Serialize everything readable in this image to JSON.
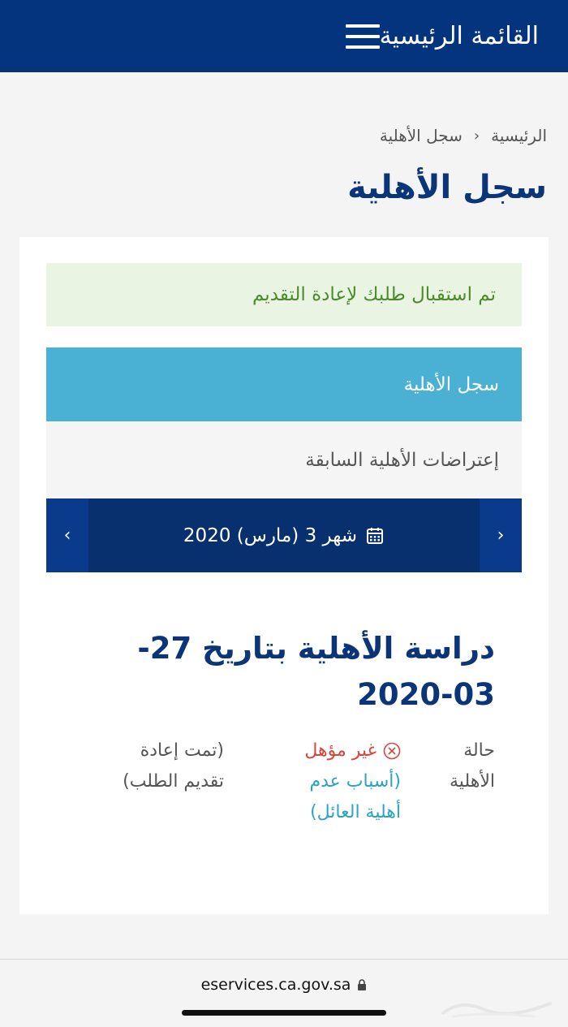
{
  "header": {
    "title": "القائمة الرئيسية",
    "menu_icon": "hamburger-menu-icon"
  },
  "breadcrumb": {
    "home": "الرئيسية",
    "current": "سجل الأهلية"
  },
  "page_title": "سجل الأهلية",
  "alert": {
    "message": "تم استقبال طلبك لإعادة التقديم",
    "color": "#4a8b2a"
  },
  "tabs": {
    "active": "سجل الأهلية",
    "inactive": "إعتراضات الأهلية السابقة"
  },
  "month_nav": {
    "label": "شهر 3 (مارس) 2020",
    "prev_symbol": "‹",
    "next_symbol": "›"
  },
  "study": {
    "title": "دراسة الأهلية بتاريخ 27-03-2020",
    "status_label": "حالة الأهلية",
    "status_value": "غير مؤهل",
    "reasons_link": "(أسباب عدم أهلية العائل)",
    "note": "(تمت إعادة تقديم الطلب)"
  },
  "browser": {
    "url": "eservices.ca.gov.sa"
  },
  "colors": {
    "header_bg": "#05347f",
    "title": "#0a3578",
    "tab_active_bg": "#4ab1d4",
    "error": "#d9443b",
    "link": "#2aa3c4"
  }
}
